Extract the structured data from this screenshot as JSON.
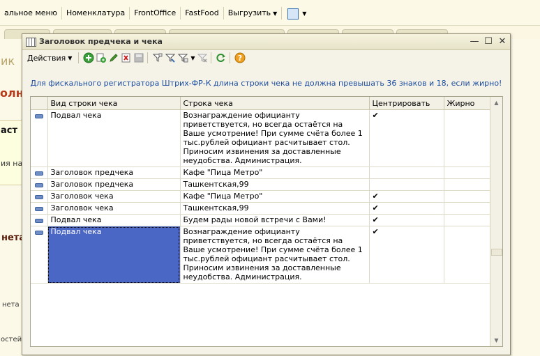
{
  "app": {
    "menu": [
      {
        "label": "альное меню"
      },
      {
        "label": "Номенклатура"
      },
      {
        "label": "FrontOffice"
      },
      {
        "label": "FastFood"
      },
      {
        "label": "Выгрузить"
      }
    ],
    "left_fragments": [
      "ик",
      "олн",
      "аст",
      "ия наж",
      "нета",
      "нета",
      "остей и"
    ]
  },
  "dialog": {
    "title": "Заголовок предчека и чека",
    "toolbar": {
      "actions_label": "Действия",
      "icons": [
        "add-icon",
        "copy-icon",
        "edit-icon",
        "delete-icon",
        "save-icon",
        "filter-icon",
        "filter-select-icon",
        "filter-dropdown-icon",
        "filter-clear-icon",
        "refresh-icon",
        "help-icon"
      ]
    },
    "info_text": "Для фискального регистратора Штрих-ФР-К длина строки чека не должна превышать 36 знаков и 18, если жирно!",
    "columns": [
      "Вид строки чека",
      "Строка чека",
      "Центрировать",
      "Жирно"
    ],
    "rows": [
      {
        "kind": "Подвал чека",
        "text": "Вознаграждение официанту приветствуется, но всегда остаётся на Ваше усмотрение!    При сумме счёта более 1 тыс.рублей официант расчитывает стол. Приносим извинения за доставленные неудобства. Администрация.",
        "center": "✔",
        "bold": ""
      },
      {
        "kind": "Заголовок предчека",
        "text": "Кафе \"Пица Метро\"",
        "center": "",
        "bold": ""
      },
      {
        "kind": "Заголовок предчека",
        "text": "Ташкентская,99",
        "center": "",
        "bold": ""
      },
      {
        "kind": "Заголовок чека",
        "text": "Кафе \"Пица Метро\"",
        "center": "✔",
        "bold": ""
      },
      {
        "kind": "Заголовок чека",
        "text": "Ташкентская,99",
        "center": "✔",
        "bold": ""
      },
      {
        "kind": "Подвал чека",
        "text": "Будем рады новой встречи с Вами!",
        "center": "✔",
        "bold": ""
      },
      {
        "kind": "Подвал чека",
        "text": "Вознаграждение официанту приветствуется, но всегда остаётся на Ваше усмотрение!    При сумме счёта более 1 тыс.рублей официант расчитывает стол. Приносим извинения за доставленные неудобства. Администрация.",
        "center": "✔",
        "bold": "",
        "selected": true
      }
    ]
  }
}
